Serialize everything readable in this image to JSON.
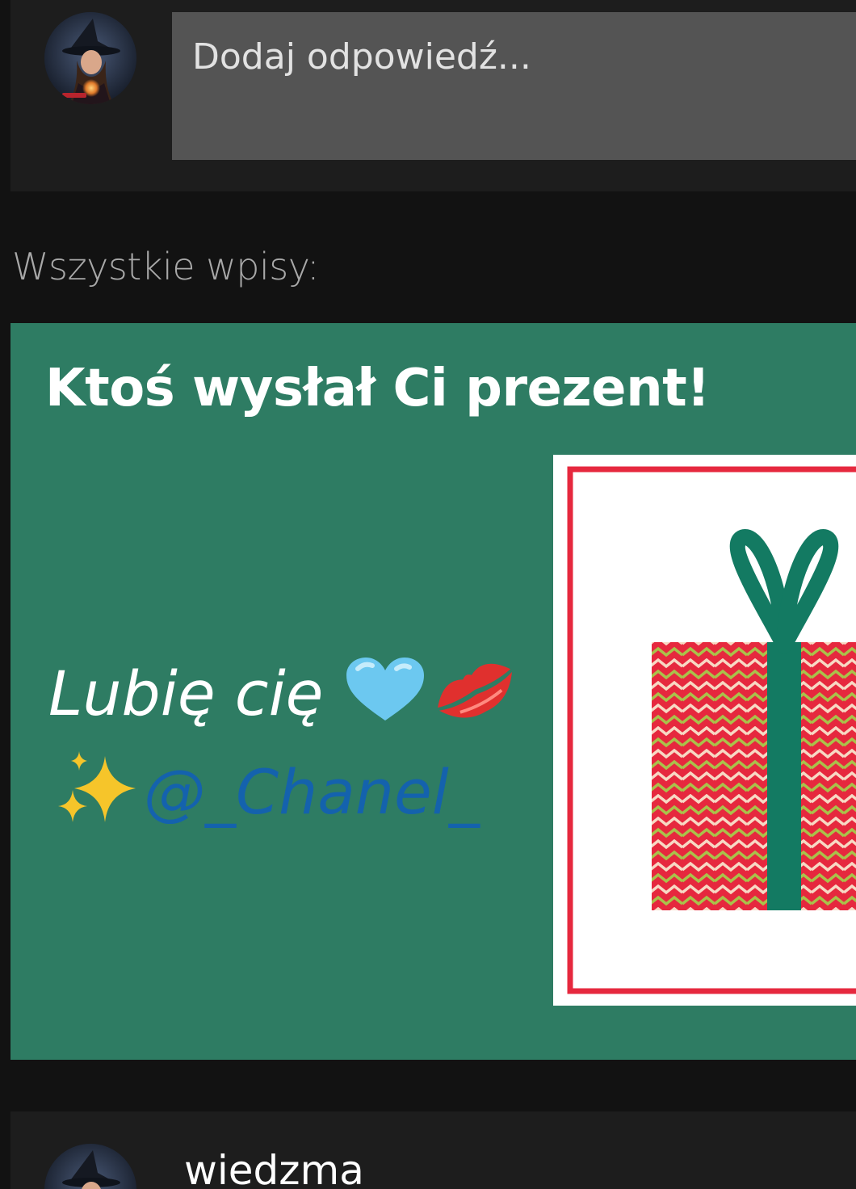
{
  "reply": {
    "placeholder": "Dodaj odpowiedź..."
  },
  "feed": {
    "section_title": "Wszystkie wpisy:"
  },
  "gift_post": {
    "title": "Ktoś wysłał Ci prezent!",
    "message_text": "Lubię cię",
    "mention": "@_Chanel_",
    "emojis": [
      "light-blue-heart",
      "kiss-mark",
      "sparkles"
    ],
    "background_color": "#2e7c63"
  },
  "next_post": {
    "author": "wiedzma"
  },
  "colors": {
    "page_bg": "#121212",
    "panel_bg": "#1d1d1d",
    "input_bg": "#545454",
    "mention": "#1462ad",
    "gift_red": "#e6283e",
    "ribbon": "#137a62"
  }
}
